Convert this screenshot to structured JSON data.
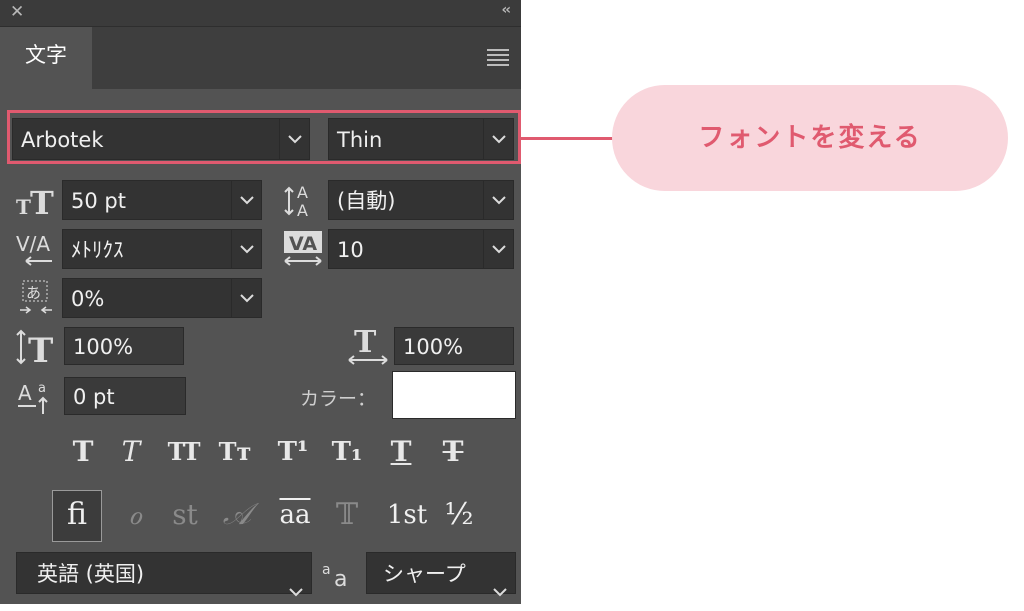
{
  "panel": {
    "tab_label": "文字",
    "font_family": "Arbotek",
    "font_style": "Thin",
    "font_size": "50 pt",
    "leading": "(自動)",
    "kerning": "ﾒﾄﾘｸｽ",
    "tracking": "10",
    "tsume": "0%",
    "vertical_scale": "100%",
    "horizontal_scale": "100%",
    "baseline_shift": "0 pt",
    "color_label": "カラー：",
    "color_value": "#ffffff",
    "language": "英語 (英国)",
    "antialias": "シャープ",
    "style_buttons": [
      "T",
      "T",
      "TT",
      "Tт",
      "T¹",
      "T₁",
      "T",
      "T"
    ],
    "opentype_buttons": [
      "ﬁ",
      "ℴ",
      "st",
      "𝒜",
      "aa",
      "𝕋",
      "1st",
      "½"
    ]
  },
  "callout": {
    "text": "フォントを変える"
  },
  "colors": {
    "accent": "#e05a6f",
    "callout_bg": "#f9d6dc",
    "panel_bg": "#535353"
  },
  "icons": [
    "close-icon",
    "collapse-icon",
    "panel-menu-icon",
    "chevron-down-icon",
    "font-size-icon",
    "leading-icon",
    "kerning-icon",
    "tracking-icon",
    "tsume-icon",
    "vertical-scale-icon",
    "horizontal-scale-icon",
    "baseline-shift-icon",
    "antialias-icon"
  ]
}
